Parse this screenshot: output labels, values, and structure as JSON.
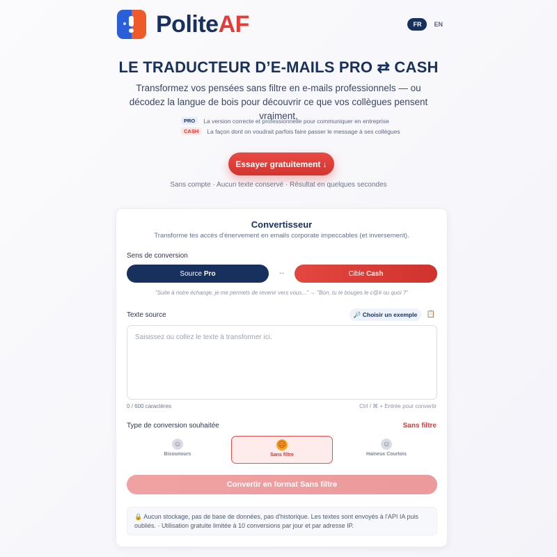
{
  "brand": {
    "name_part1": "Polite",
    "name_part2": "AF"
  },
  "language": {
    "active": "FR",
    "inactive": "EN"
  },
  "hero": {
    "title": "LE TRADUCTEUR D’E-MAILS PRO ⇄ CASH",
    "subtitle": "Transformez vos pensées sans filtre en e-mails professionnels — ou décodez la langue de bois pour découvrir ce que vos collègues pensent vraiment.",
    "legend": [
      {
        "tag": "PRO",
        "text": "La version correcte et professionnelle pour communiquer en entreprise"
      },
      {
        "tag": "CASH",
        "text": "La façon dont on voudrait parfois faire passer le message à ses collègues"
      }
    ],
    "cta_label": "Essayer gratuitement ↓",
    "cta_note": "Sans compte · Aucun texte conservé · Résultat en quelques secondes"
  },
  "converter": {
    "title": "Convertisseur",
    "subtitle": "Transforme tes accès d'énervement en emails corporate impeccables (et inversement).",
    "direction_label": "Sens de conversion",
    "source": {
      "prefix": "Source",
      "value": "Pro"
    },
    "target": {
      "prefix": "Cible",
      "value": "Cash"
    },
    "swap_symbol": "↔",
    "example": "\"Suite à notre échange, je me permets de revenir vers vous...\" → \"Bon, tu te bouges le c@# ou quoi ?\"",
    "source_text_label": "Texte source",
    "pick_example_label": "🔎 Choisir un exemple",
    "clipboard_icon": "📋",
    "placeholder": "Saisissez ou collez le texte à transformer ici.",
    "char_count": "0 / 600 caractères",
    "shortcut_hint": "Ctrl / ⌘ + Entrée pour convertir",
    "type_label": "Type de conversion souhaitée",
    "type_value": "Sans filtre",
    "options": [
      {
        "label": "Bisounours",
        "emoji": "☺",
        "selected": false
      },
      {
        "label": "Sans filtre",
        "emoji": "☹",
        "selected": true
      },
      {
        "label": "Haineux Courtois",
        "emoji": "☺",
        "selected": false
      }
    ],
    "convert_label": "Convertir en format Sans filtre",
    "privacy_icon": "🔒",
    "privacy_note": "Aucun stockage, pas de base de données, pas d'historique. Les textes sont envoyés à l'API IA puis oubliés. · Utilisation gratuite limitée à 10 conversions par jour et par adresse IP."
  },
  "colors": {
    "navy": "#17305e",
    "red": "#e23c37",
    "blue": "#2b5fd9",
    "orange": "#ef5a2a"
  }
}
